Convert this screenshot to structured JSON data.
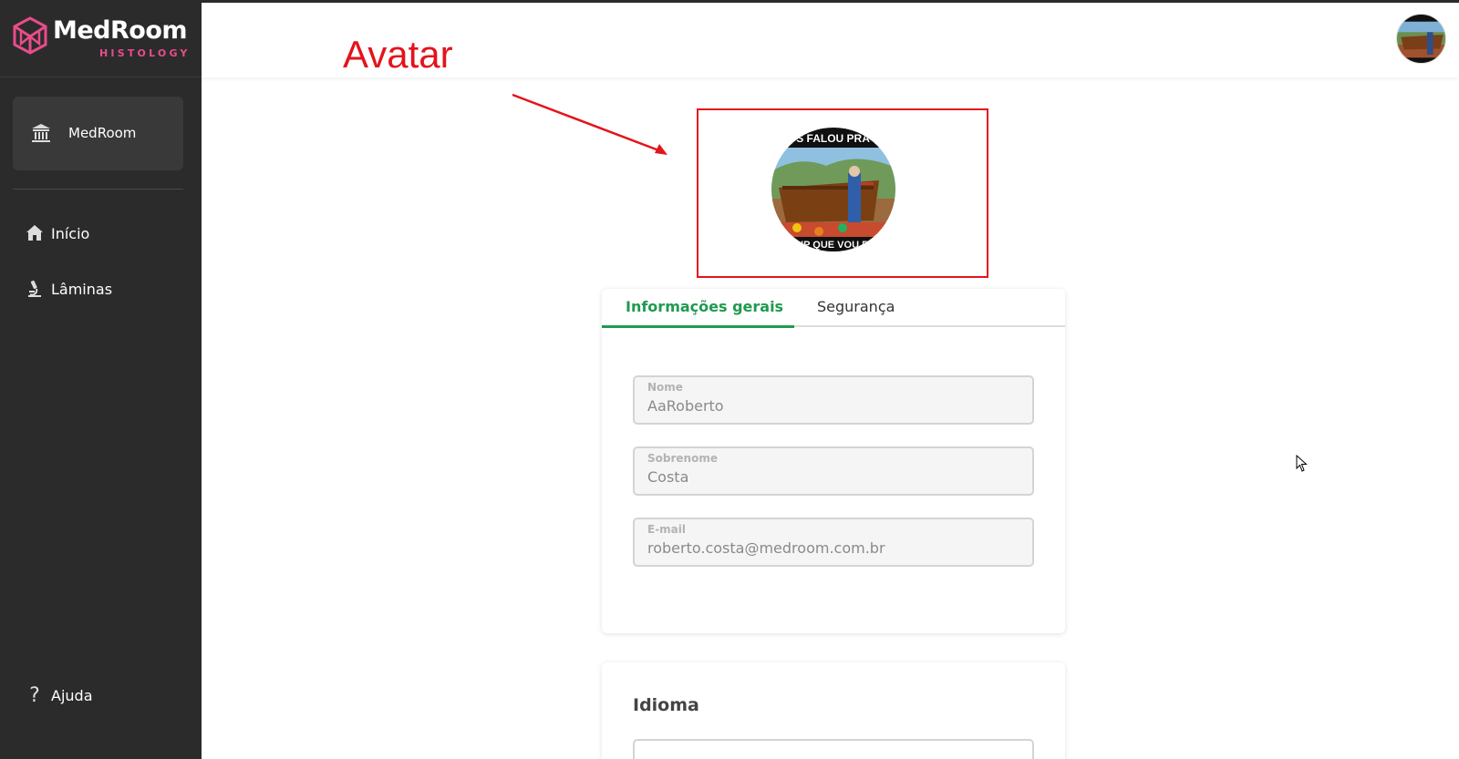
{
  "brand": {
    "name": "MedRoom",
    "subtitle": "HISTOLOGY",
    "accent": "#e84c8a"
  },
  "sidebar": {
    "organization": {
      "label": "MedRoom",
      "icon": "institution-icon"
    },
    "items": [
      {
        "label": "Início",
        "icon": "home-icon"
      },
      {
        "label": "Lâminas",
        "icon": "microscope-icon"
      }
    ],
    "help": {
      "label": "Ajuda",
      "icon": "question-icon"
    }
  },
  "annotation": {
    "label": "Avatar",
    "color": "#e3141b"
  },
  "avatar": {
    "caption_top": "DEUS FALOU PRA MIM",
    "caption_bottom": "BUILD UP QUE VOU ENCHER"
  },
  "profile": {
    "tabs": [
      {
        "label": "Informações gerais",
        "active": true
      },
      {
        "label": "Segurança",
        "active": false
      }
    ],
    "fields": {
      "nome": {
        "label": "Nome",
        "value": "AaRoberto"
      },
      "sobrenome": {
        "label": "Sobrenome",
        "value": "Costa"
      },
      "email": {
        "label": "E-mail",
        "value": "roberto.costa@medroom.com.br"
      }
    },
    "accent": "#1f9a4f"
  },
  "language": {
    "title": "Idioma"
  }
}
